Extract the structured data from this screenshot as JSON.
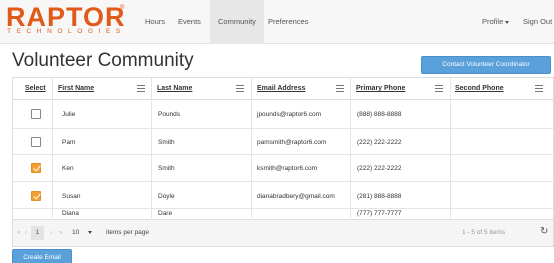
{
  "brand": {
    "logo_text": "RAPTOR",
    "logo_sub": "TECHNOLOGIES",
    "logo_tm": "®",
    "color": "#e05a1a"
  },
  "nav": {
    "items": [
      {
        "label": "Hours"
      },
      {
        "label": "Events"
      },
      {
        "label": "Community"
      },
      {
        "label": "Preferences"
      }
    ],
    "active": "Community",
    "profile_label": "Profile",
    "signout_label": "Sign Out"
  },
  "page": {
    "title": "Volunteer Community",
    "coordinator_button": "Contact Volunteer Coordinator",
    "create_email_button": "Create Email",
    "accent_color": "#5aa0db"
  },
  "grid": {
    "columns": [
      {
        "label": "Select"
      },
      {
        "label": "First Name"
      },
      {
        "label": "Last Name"
      },
      {
        "label": "Email Address"
      },
      {
        "label": "Primary Phone"
      },
      {
        "label": "Second Phone"
      }
    ],
    "rows": [
      {
        "selected": false,
        "first": "Julie",
        "last": "Pounds",
        "email": "jpounds@raptor6.com",
        "phone": "(888) 888-8888",
        "phone2": ""
      },
      {
        "selected": false,
        "first": "Pam",
        "last": "Smith",
        "email": "pamsmith@raptor6.com",
        "phone": "(222) 222-2222",
        "phone2": ""
      },
      {
        "selected": true,
        "first": "Ken",
        "last": "Smith",
        "email": "ksmith@raptor6.com",
        "phone": "(222) 222-2222",
        "phone2": ""
      },
      {
        "selected": true,
        "first": "Susan",
        "last": "Doyle",
        "email": "dianabradbery@gmail.com",
        "phone": "(281) 888-8888",
        "phone2": ""
      },
      {
        "selected": false,
        "first": "Diana",
        "last": "Dare",
        "email": "",
        "phone": "(777) 777-7777",
        "phone2": ""
      }
    ],
    "checked_color": "#f0a030"
  },
  "pager": {
    "first": "«",
    "prev": "‹",
    "current_page": "1",
    "next": "›",
    "last": "»",
    "page_size": "10",
    "page_size_label": "items per page",
    "info": "1 - 5 of 5 items",
    "refresh_icon": "refresh-icon"
  }
}
